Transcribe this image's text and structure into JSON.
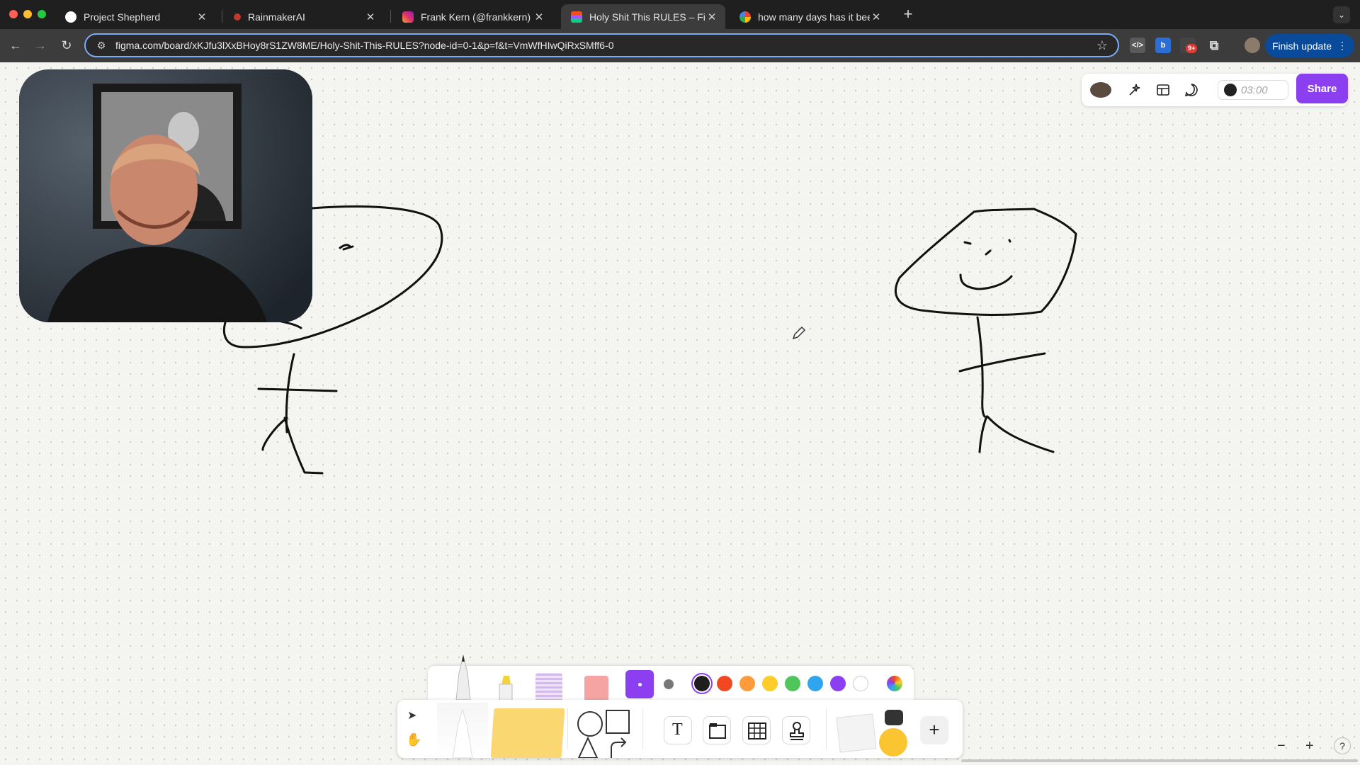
{
  "browser": {
    "tabs": [
      {
        "title": "Project Shepherd",
        "icon": "shepherd-icon",
        "active": false
      },
      {
        "title": "RainmakerAI",
        "icon": "rainmaker-icon",
        "active": false
      },
      {
        "title": "Frank Kern (@frankkern) • Ins",
        "icon": "instagram-icon",
        "active": false
      },
      {
        "title": "Holy Shit This RULES – FigJa",
        "icon": "figma-icon",
        "active": true
      },
      {
        "title": "how many days has it been si",
        "icon": "google-icon",
        "active": false
      }
    ],
    "new_tab": "+",
    "url": "figma.com/board/xKJfu3lXxBHoy8rS1ZW8ME/Holy-Shit-This-RULES?node-id=0-1&p=f&t=VmWfHIwQiRxSMff6-0",
    "finish_update_label": "Finish update",
    "extension_badge": "9+"
  },
  "figjam": {
    "timer": "03:00",
    "share_label": "Share",
    "colors": [
      "#1e1e1e",
      "#f24822",
      "#ff9a3d",
      "#ffcd29",
      "#4fc65b",
      "#2fa4ef",
      "#8b3ff0",
      "#ffffff"
    ],
    "selected_color": "#1e1e1e",
    "selected_stroke_color": "#8b3ff0",
    "zoom_out": "−",
    "zoom_in": "+",
    "help": "?"
  }
}
